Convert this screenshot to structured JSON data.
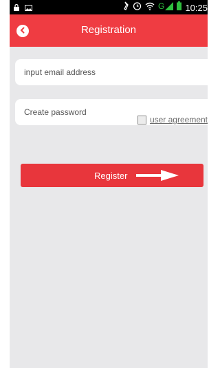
{
  "status_bar": {
    "time": "10:25",
    "icons": [
      "lock-icon",
      "image-icon",
      "alarm-icon",
      "clock-icon",
      "wifi-icon",
      "signal-icon",
      "battery-icon"
    ]
  },
  "header": {
    "title": "Registration",
    "back_icon": "chevron-left-icon"
  },
  "form": {
    "email_placeholder": "input email address",
    "password_placeholder": "Create password",
    "agreement_label": "user agreement",
    "agreement_checked": false,
    "register_label": "Register"
  },
  "colors": {
    "accent": "#ef3c42",
    "button": "#e8363c",
    "background": "#e8e8ea"
  }
}
